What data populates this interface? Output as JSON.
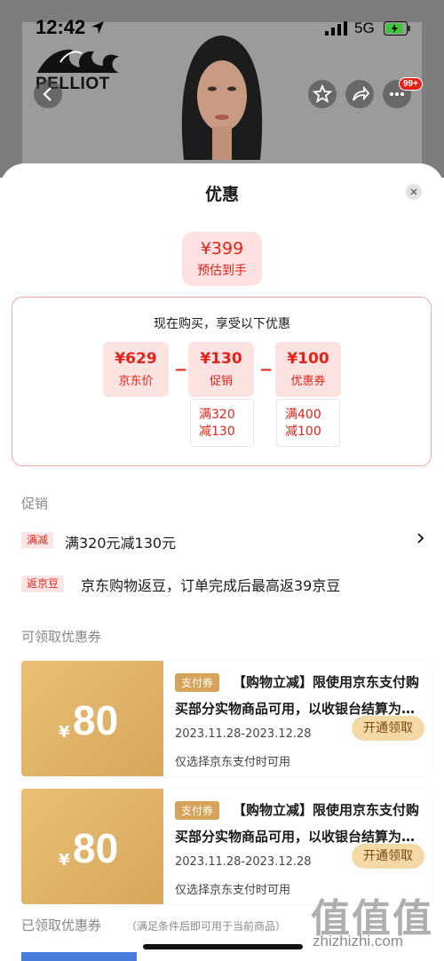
{
  "status_bar": {
    "time": "12:42",
    "network": "5G"
  },
  "brand": {
    "logo_text": "PELLIOT"
  },
  "header": {
    "cart_badge": "99+"
  },
  "sheet": {
    "title": "优惠"
  },
  "estimate": {
    "price": "¥399",
    "label": "预估到手"
  },
  "breakdown": {
    "title": "现在购买，享受以下优惠",
    "items": [
      {
        "price": "¥629",
        "label": "京东价"
      },
      {
        "price": "¥130",
        "label": "促销",
        "detail": [
          "满320",
          "减130"
        ]
      },
      {
        "price": "¥100",
        "label": "优惠券",
        "detail": [
          "满400",
          "减100"
        ]
      }
    ],
    "minus": "−"
  },
  "promotions": {
    "heading": "促销",
    "items": [
      {
        "tag": "满减",
        "text": "满320元减130元"
      },
      {
        "tag": "返京豆",
        "text": "京东购物返豆，订单完成后最高返39京豆"
      }
    ]
  },
  "coupons": {
    "heading": "可领取优惠券",
    "items": [
      {
        "symbol": "¥",
        "amount": "80",
        "tag": "支付券",
        "title_line1": "【购物立减】限使用京东支付购",
        "title_line2": "买部分实物商品可用，以收银台结算为…",
        "date": "2023.11.28-2023.12.28",
        "note": "仅选择京东支付时可用",
        "button": "开通领取"
      },
      {
        "symbol": "¥",
        "amount": "80",
        "tag": "支付券",
        "title_line1": "【购物立减】限使用京东支付购",
        "title_line2": "买部分实物商品可用，以收银台结算为…",
        "date": "2023.11.28-2023.12.28",
        "note": "仅选择京东支付时可用",
        "button": "开通领取"
      }
    ]
  },
  "claimed": {
    "heading": "已领取优惠券",
    "note": "（满足条件后即可用于当前商品）"
  },
  "watermark": {
    "glyphs": "值值值",
    "site": "zhizhizhi.com"
  },
  "colors": {
    "accent": "#e2231a",
    "coupon_gold": "#d6a65b"
  }
}
